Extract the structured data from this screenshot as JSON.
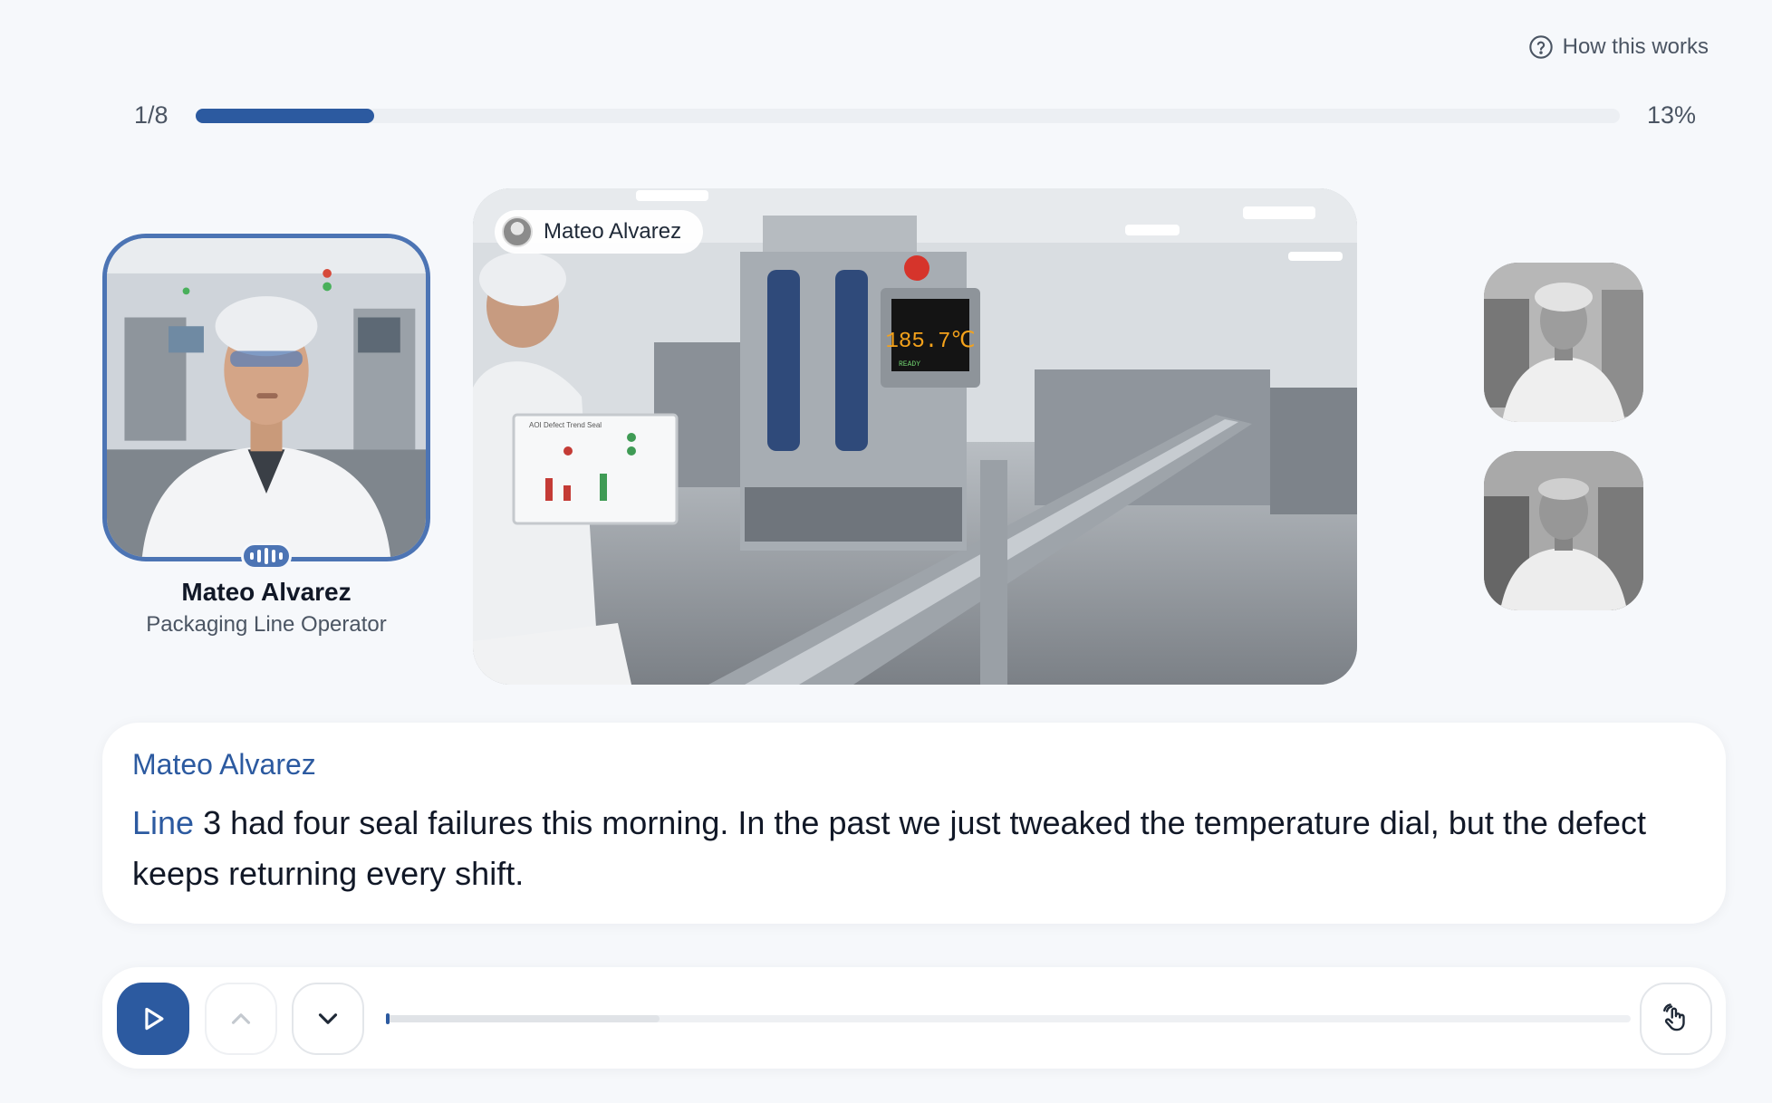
{
  "help": {
    "label": "How this works",
    "icon": "question-circle-icon"
  },
  "progress": {
    "step_label": "1/8",
    "percent_label": "13%",
    "fraction": 0.125
  },
  "speaker": {
    "name": "Mateo Alvarez",
    "role": "Packaging Line Operator",
    "speaking_icon": "audio-wave-icon"
  },
  "scene": {
    "tag_name": "Mateo Alvarez",
    "monitor_reading": "185.7℃",
    "monitor_status": "READY",
    "whiteboard_title": "AOI Defect Trend Seal"
  },
  "transcript": {
    "speaker": "Mateo Alvarez",
    "highlight": "Line",
    "text": " 3 had four seal failures this morning. In the past we just tweaked the temperature dial, but the defect keeps returning every shift."
  },
  "player": {
    "audio_buffered_fraction": 0.22,
    "audio_played_fraction": 0.0,
    "icons": {
      "play": "play-icon",
      "previous": "chevron-up-icon",
      "next": "chevron-down-icon",
      "gesture": "hand-gesture-icon"
    }
  },
  "colors": {
    "accent": "#2c5aa0",
    "speaker_ring": "#4c74b4",
    "background": "#f6f8fb"
  }
}
